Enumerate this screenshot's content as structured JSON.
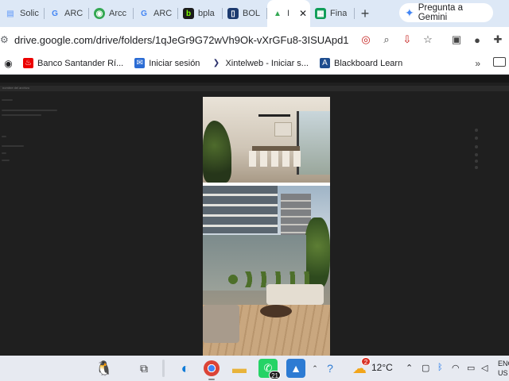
{
  "browser": {
    "tabs": [
      {
        "label": "Solic",
        "icon": "doc-icon",
        "color": "#8ab4f8"
      },
      {
        "label": "ARC",
        "icon": "google-g-icon",
        "color": "#4285f4"
      },
      {
        "label": "Arcc",
        "icon": "globe-icon",
        "color": "#34a853"
      },
      {
        "label": "ARC",
        "icon": "google-g-icon",
        "color": "#4285f4"
      },
      {
        "label": "bpla",
        "icon": "b-icon",
        "color": "#1b1b1b"
      },
      {
        "label": "BOL",
        "icon": "bol-icon",
        "color": "#1d3b6f"
      },
      {
        "label": "I",
        "icon": "drive-icon",
        "color": "#34a853"
      },
      {
        "label": "Fina",
        "icon": "sheets-icon",
        "color": "#0f9d58"
      }
    ],
    "active_tab_close": "✕",
    "new_tab": "+",
    "gemini_label": "Pregunta a Gemini",
    "url": "drive.google.com/drive/folders/1qJeGr9G72wVh9Ok-vXrGFu8-3ISUApd1",
    "bookmarks": [
      {
        "label": "Banco Santander Rí...",
        "icon": "santander-icon",
        "color": "#ec0000"
      },
      {
        "label": "Iniciar sesión",
        "icon": "mail-icon",
        "color": "#2b6cd4"
      },
      {
        "label": "Xintelweb - Iniciar s...",
        "icon": "xintel-icon",
        "color": "#2a2f6b"
      },
      {
        "label": "Blackboard Learn",
        "icon": "blackboard-icon",
        "color": "#1e4d8f"
      }
    ],
    "bookmarks_more": "»"
  },
  "viewer": {
    "header_text": "nombre del archivo"
  },
  "taskbar": {
    "weather_badge": "2",
    "temperature": "12°C",
    "whatsapp_badge": "21",
    "language_line1": "ENG",
    "language_line2": "US"
  }
}
